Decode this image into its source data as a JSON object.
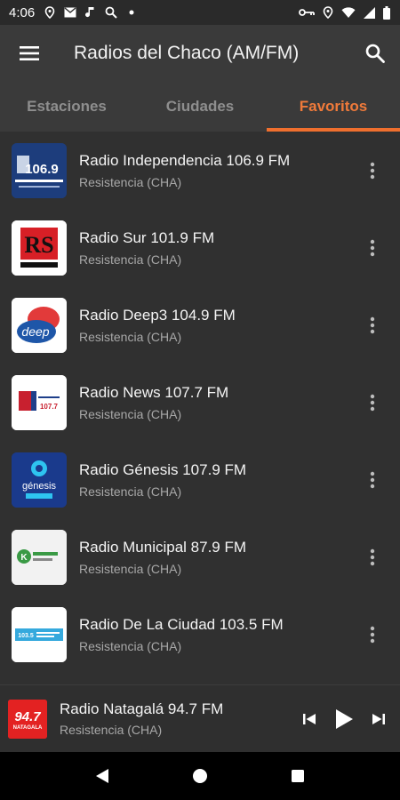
{
  "status_bar": {
    "time": "4:06",
    "icons": [
      "location-icon",
      "mail-icon",
      "music-icon",
      "search-icon",
      "dot-icon"
    ],
    "right_icons": [
      "vpn-key-icon",
      "location-icon",
      "wifi-icon",
      "signal-icon",
      "battery-icon"
    ]
  },
  "app_bar": {
    "title": "Radios del Chaco (AM/FM)"
  },
  "tabs": [
    {
      "label": "Estaciones",
      "active": false
    },
    {
      "label": "Ciudades",
      "active": false
    },
    {
      "label": "Favoritos",
      "active": true
    }
  ],
  "stations": [
    {
      "name": "Radio Independencia 106.9 FM",
      "city": "Resistencia (CHA)",
      "logo_text": "106.9"
    },
    {
      "name": "Radio Sur 101.9 FM",
      "city": "Resistencia (CHA)",
      "logo_text": "RS"
    },
    {
      "name": "Radio Deep3 104.9 FM",
      "city": "Resistencia (CHA)",
      "logo_text": "deep"
    },
    {
      "name": "Radio News 107.7 FM",
      "city": "Resistencia (CHA)",
      "logo_text": "107.7"
    },
    {
      "name": "Radio Génesis 107.9 FM",
      "city": "Resistencia (CHA)",
      "logo_text": "génesis"
    },
    {
      "name": "Radio Municipal 87.9 FM",
      "city": "Resistencia (CHA)",
      "logo_text": "K"
    },
    {
      "name": "Radio De La Ciudad 103.5 FM",
      "city": "Resistencia (CHA)",
      "logo_text": "103.5"
    }
  ],
  "now_playing": {
    "name": "Radio Natagalá 94.7 FM",
    "city": "Resistencia (CHA)",
    "logo_text": "94.7",
    "logo_subtext": "NATAGALA"
  },
  "colors": {
    "accent": "#ef6f2e",
    "app_bar": "#3a3a3a",
    "background": "#303030"
  }
}
